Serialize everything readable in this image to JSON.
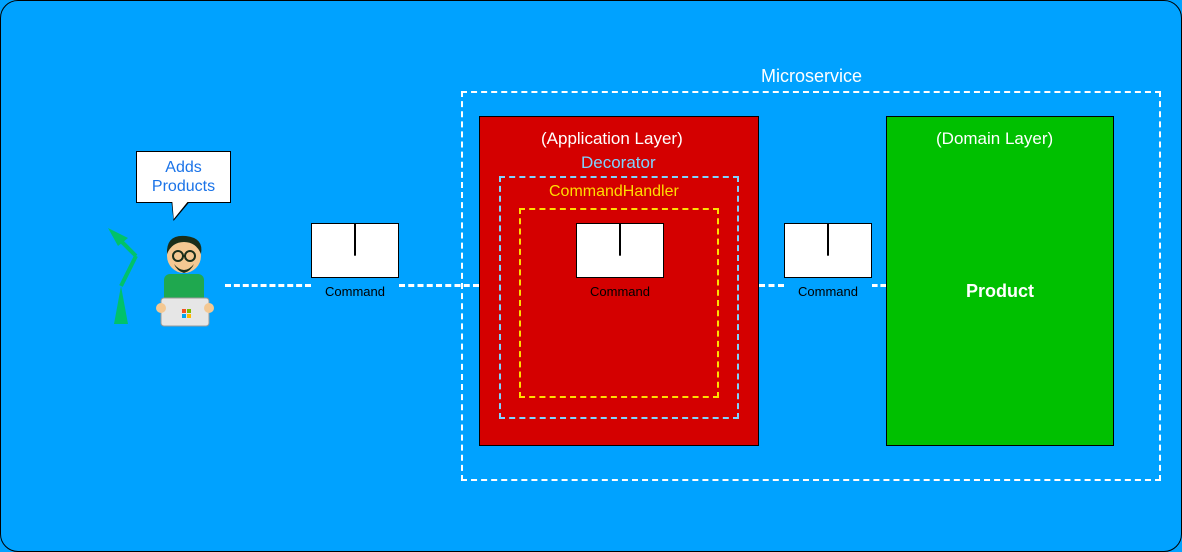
{
  "microservice": {
    "label": "Microservice",
    "application_layer": {
      "label": "(Application Layer)",
      "decorator": {
        "label": "Decorator",
        "command_handler": {
          "label": "CommandHandler",
          "command": {
            "label": "Command"
          }
        }
      }
    },
    "domain_layer": {
      "label": "(Domain Layer)",
      "entity": "Product"
    }
  },
  "actor": {
    "speech": "Adds Products",
    "speech_line1": "Adds",
    "speech_line2": "Products"
  },
  "commands": {
    "to_app": "Command",
    "in_handler": "Command",
    "to_domain": "Command"
  }
}
